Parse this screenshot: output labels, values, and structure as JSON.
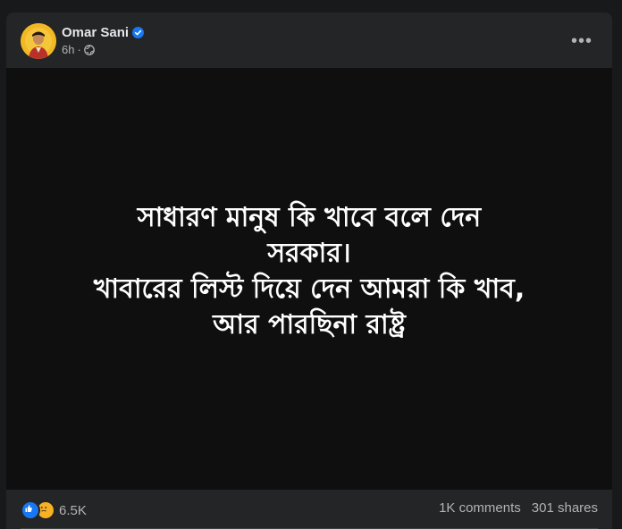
{
  "post": {
    "author": {
      "name": "Omar Sani",
      "verified": true,
      "avatar_icon": "avatar-photo"
    },
    "meta": {
      "time": "6h",
      "separator": "·",
      "privacy_icon": "globe-icon"
    },
    "more_icon": "more-options-icon",
    "more_label": "•••",
    "image_text": {
      "lines": [
        "সাধারণ মানুষ কি খাবে বলে দেন",
        "সরকার।",
        "খাবারের লিস্ট দিয়ে দেন আমরা কি খাব,",
        "আর পারছিনা রাষ্ট্র"
      ]
    }
  },
  "footer": {
    "reaction_icons": [
      "like-reaction-icon",
      "sad-reaction-icon"
    ],
    "reaction_count": "6.5K",
    "comments": "1K comments",
    "shares": "301 shares"
  },
  "colors": {
    "background": "#18191a",
    "card": "#242526",
    "image_background": "#0f0f0f",
    "text_primary": "#e4e6eb",
    "text_secondary": "#b0b3b8",
    "verified": "#1877f2"
  }
}
